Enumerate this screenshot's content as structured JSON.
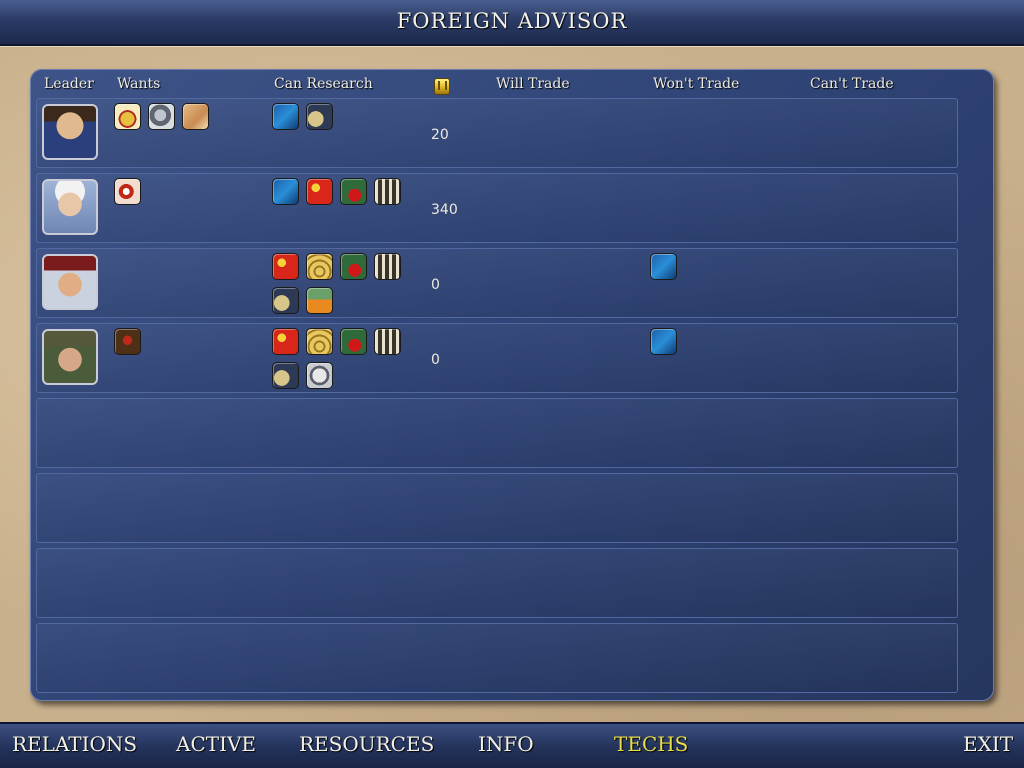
{
  "window": {
    "title": "FOREIGN ADVISOR"
  },
  "columns": {
    "leader": "Leader",
    "wants": "Wants",
    "can_research": "Can Research",
    "gold_icon": "gold-icon",
    "will_trade": "Will Trade",
    "wont_trade": "Won't Trade",
    "cant_trade": "Can't Trade"
  },
  "rows": [
    {
      "leader": "chinese-leader-portrait",
      "wants": [
        "crown-icon",
        "statue-icon",
        "hand-icon"
      ],
      "can_research": [
        "blue-hand-icon",
        "gear-coin-icon"
      ],
      "gold": "20",
      "will_trade": [],
      "wont_trade": []
    },
    {
      "leader": "scientist-leader-portrait",
      "wants": [
        "eye-icon"
      ],
      "can_research": [
        "blue-hand-icon",
        "flag-icon",
        "apple-icon",
        "abacus-icon"
      ],
      "gold": "340",
      "will_trade": [],
      "wont_trade": []
    },
    {
      "leader": "russian-leader-portrait",
      "wants": [],
      "can_research": [
        "flag-icon",
        "coins-icon",
        "apple-icon",
        "abacus-icon",
        "gear-coin-icon",
        "flask-icon"
      ],
      "gold": "0",
      "will_trade": [],
      "wont_trade": [
        "blue-hand-icon"
      ]
    },
    {
      "leader": "french-leader-portrait",
      "wants": [
        "figure-icon"
      ],
      "can_research": [
        "flag-icon",
        "coins-icon",
        "apple-icon",
        "abacus-icon",
        "gear-coin-icon",
        "compass-icon"
      ],
      "gold": "0",
      "will_trade": [],
      "wont_trade": [
        "blue-hand-icon"
      ]
    }
  ],
  "tabs": [
    {
      "label": "RELATIONS",
      "active": false
    },
    {
      "label": "ACTIVE",
      "active": false
    },
    {
      "label": "RESOURCES",
      "active": false
    },
    {
      "label": "INFO",
      "active": false
    },
    {
      "label": "TECHS",
      "active": true
    },
    {
      "label": "EXIT",
      "active": false
    }
  ],
  "colors": {
    "panel": "#2f4375",
    "parchment": "#c9b08c",
    "active_tab": "#e8dc4a"
  }
}
